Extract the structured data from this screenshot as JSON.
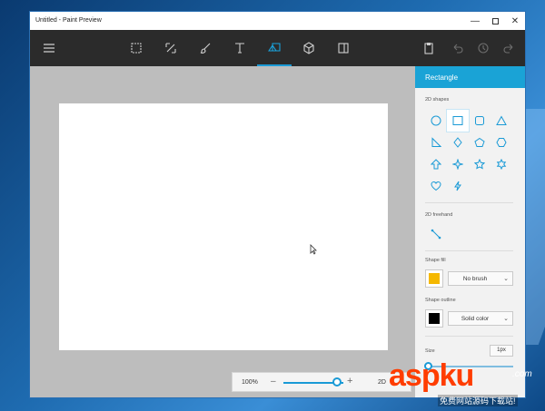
{
  "window": {
    "title": "Untitled - Paint Preview"
  },
  "toolbar": {
    "items": [
      {
        "name": "menu-icon"
      },
      {
        "name": "select-icon"
      },
      {
        "name": "crop-icon"
      },
      {
        "name": "brush-icon"
      },
      {
        "name": "text-icon"
      },
      {
        "name": "shapes-icon",
        "active": true
      },
      {
        "name": "3d-object-icon"
      },
      {
        "name": "sticker-icon"
      },
      {
        "name": "paste-icon"
      },
      {
        "name": "undo-icon"
      },
      {
        "name": "history-icon"
      },
      {
        "name": "redo-icon"
      }
    ]
  },
  "zoom": {
    "percent_label": "100%",
    "minus": "–",
    "plus": "+",
    "mode_label": "2D",
    "level": 0.45
  },
  "panel": {
    "title": "Rectangle",
    "shapes_label": "2D shapes",
    "shapes": [
      "circle-icon",
      "rectangle-icon",
      "rounded-rectangle-icon",
      "triangle-icon",
      "right-triangle-icon",
      "diamond-icon",
      "pentagon-icon",
      "hexagon-icon",
      "arrow-up-icon",
      "four-point-star-icon",
      "star-icon",
      "six-point-star-icon",
      "heart-icon",
      "lightning-icon"
    ],
    "selected_shape": "rectangle-icon",
    "freehand_label": "2D freehand",
    "fill_label": "Shape fill",
    "fill_value": "No brush",
    "fill_color": "#f5b800",
    "outline_label": "Shape outline",
    "outline_value": "Solid color",
    "outline_color": "#000000",
    "size_label": "Size",
    "size_value": "1px",
    "size_level": 0.0
  },
  "colors": {
    "accent": "#1aa3d6",
    "toolbar_bg": "#2b2b2b"
  },
  "watermark": {
    "main": "aspku",
    "tld": ".com",
    "sub": "免费网站源码下载站!"
  }
}
